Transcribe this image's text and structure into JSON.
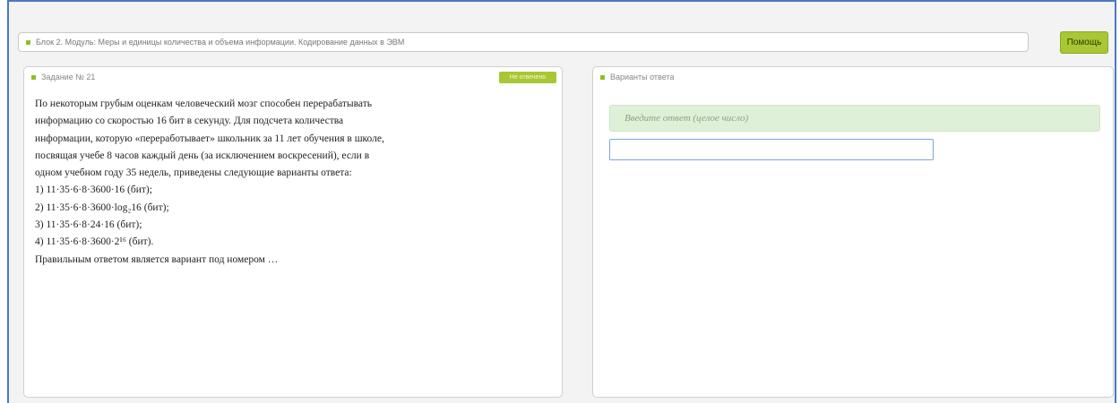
{
  "header": {
    "breadcrumb": "Блок 2. Модуль: Меры и единицы количества и объема информации. Кодирование данных в ЭВМ",
    "help_button": "Помощь"
  },
  "task": {
    "title": "Задание № 21",
    "badge": "Не отвечено",
    "lines": [
      "По некоторым грубым оценкам человеческий мозг способен перерабатывать",
      "информацию со скоростью 16 бит в секунду. Для подсчета количества",
      "информации, которую «переработывает» школьник за 11 лет обучения в школе,",
      "посвящая учебе 8 часов каждый день (за исключением воскресений), если в",
      "одном учебном году 35 недель, приведены следующие варианты ответа:",
      "1) 11·35·6·8·3600·16 (бит);",
      "2) 11·35·6·8·3600·log₂16 (бит);",
      "3) 11·35·6·8·24·16 (бит);",
      "4) 11·35·6·8·3600·2¹⁶ (бит).",
      "Правильным ответом является вариант под номером …"
    ]
  },
  "answer": {
    "title": "Варианты ответа",
    "hint": "Введите ответ (целое число)",
    "input_value": ""
  },
  "colors": {
    "accent": "#a8c734",
    "frame": "#4a78c4",
    "hint_bg": "#dff0d8"
  }
}
